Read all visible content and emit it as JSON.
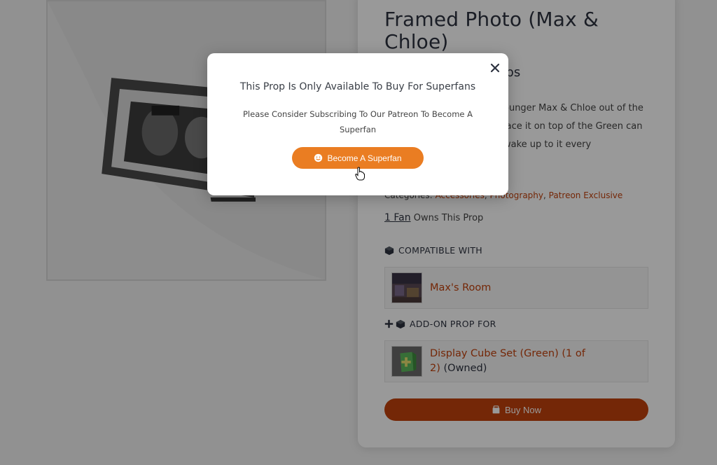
{
  "product": {
    "title": "Framed Photo (Max & Chloe)",
    "subtitle": "rbs",
    "description": "ounger Max & Chloe out of the lace it on top of the Green can wake up to it every",
    "categories_label": "Categories:",
    "categories": [
      "Accessories",
      "Photography",
      "Patreon Exclusive"
    ],
    "fans_link": "1 Fan",
    "fans_suffix": "Owns This Prop"
  },
  "compatible": {
    "heading": "COMPATIBLE WITH",
    "icon": "cube-icon",
    "item_name": "Max's Room"
  },
  "addon": {
    "heading": "ADD-ON PROP FOR",
    "icon": "plus-cube-icon",
    "item_name": "Display Cube Set (Green) (1 of 2)",
    "item_status": "(Owned)"
  },
  "buy_button": {
    "label": "Buy Now",
    "icon": "cart-icon"
  },
  "modal": {
    "title": "This Prop Is Only Available To Buy For Superfans",
    "text": "Please Consider Subscribing To Our Patreon To Become A Superfan",
    "button_label": "Become A Superfan",
    "button_icon": "smile-icon",
    "close_icon": "close-icon"
  },
  "colors": {
    "accent": "#c2410c",
    "superfan_button": "#ea7d22",
    "overlay": "rgba(0,0,0,0.40)"
  }
}
